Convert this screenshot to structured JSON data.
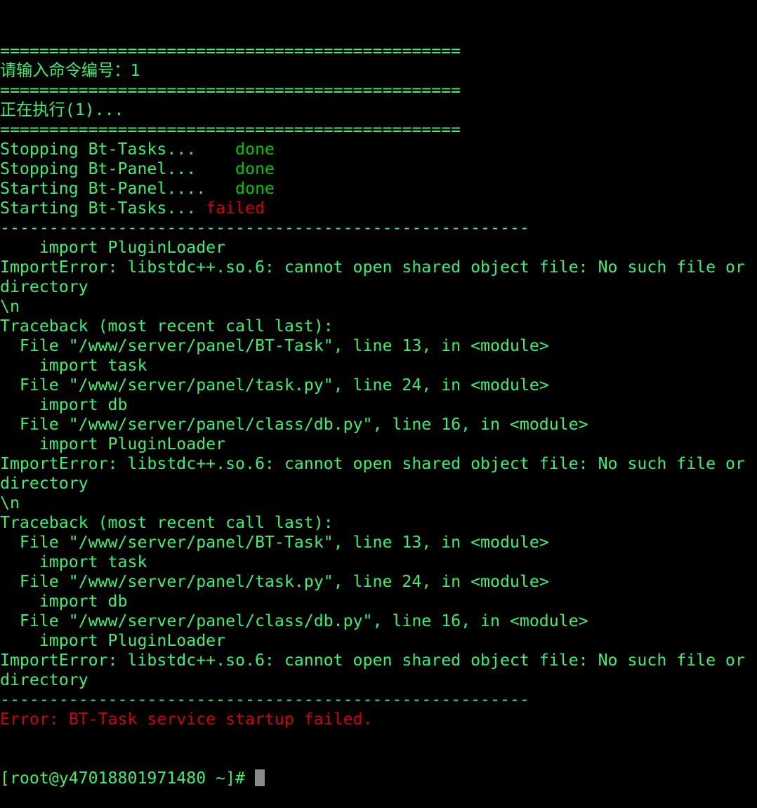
{
  "colors": {
    "text": "#3cf06e",
    "ok": "#00c400",
    "error": "#d40000",
    "background": "#000000"
  },
  "lines": [
    [
      {
        "t": "===============================================",
        "c": ""
      }
    ],
    [
      {
        "t": "请输入命令编号：1",
        "c": ""
      }
    ],
    [
      {
        "t": "===============================================",
        "c": ""
      }
    ],
    [
      {
        "t": "正在执行(1)...",
        "c": ""
      }
    ],
    [
      {
        "t": "===============================================",
        "c": ""
      }
    ],
    [
      {
        "t": "Stopping Bt-Tasks...    ",
        "c": ""
      },
      {
        "t": "done",
        "c": "ok"
      }
    ],
    [
      {
        "t": "Stopping Bt-Panel...    ",
        "c": ""
      },
      {
        "t": "done",
        "c": "ok"
      }
    ],
    [
      {
        "t": "Starting Bt-Panel....   ",
        "c": ""
      },
      {
        "t": "done",
        "c": "ok"
      }
    ],
    [
      {
        "t": "Starting Bt-Tasks... ",
        "c": ""
      },
      {
        "t": "failed",
        "c": "err"
      }
    ],
    [
      {
        "t": "------------------------------------------------------",
        "c": ""
      }
    ],
    [
      {
        "t": "    import PluginLoader",
        "c": ""
      }
    ],
    [
      {
        "t": "ImportError: libstdc++.so.6: cannot open shared object file: No such file or",
        "c": ""
      }
    ],
    [
      {
        "t": "directory",
        "c": ""
      }
    ],
    [
      {
        "t": "\\n",
        "c": ""
      }
    ],
    [
      {
        "t": "Traceback (most recent call last):",
        "c": ""
      }
    ],
    [
      {
        "t": "  File \"/www/server/panel/BT-Task\", line 13, in <module>",
        "c": ""
      }
    ],
    [
      {
        "t": "    import task",
        "c": ""
      }
    ],
    [
      {
        "t": "  File \"/www/server/panel/task.py\", line 24, in <module>",
        "c": ""
      }
    ],
    [
      {
        "t": "    import db",
        "c": ""
      }
    ],
    [
      {
        "t": "  File \"/www/server/panel/class/db.py\", line 16, in <module>",
        "c": ""
      }
    ],
    [
      {
        "t": "    import PluginLoader",
        "c": ""
      }
    ],
    [
      {
        "t": "ImportError: libstdc++.so.6: cannot open shared object file: No such file or",
        "c": ""
      }
    ],
    [
      {
        "t": "directory",
        "c": ""
      }
    ],
    [
      {
        "t": "\\n",
        "c": ""
      }
    ],
    [
      {
        "t": "Traceback (most recent call last):",
        "c": ""
      }
    ],
    [
      {
        "t": "  File \"/www/server/panel/BT-Task\", line 13, in <module>",
        "c": ""
      }
    ],
    [
      {
        "t": "    import task",
        "c": ""
      }
    ],
    [
      {
        "t": "  File \"/www/server/panel/task.py\", line 24, in <module>",
        "c": ""
      }
    ],
    [
      {
        "t": "    import db",
        "c": ""
      }
    ],
    [
      {
        "t": "  File \"/www/server/panel/class/db.py\", line 16, in <module>",
        "c": ""
      }
    ],
    [
      {
        "t": "    import PluginLoader",
        "c": ""
      }
    ],
    [
      {
        "t": "ImportError: libstdc++.so.6: cannot open shared object file: No such file or",
        "c": ""
      }
    ],
    [
      {
        "t": "directory",
        "c": ""
      }
    ],
    [
      {
        "t": "------------------------------------------------------",
        "c": ""
      }
    ],
    [
      {
        "t": "Error: BT-Task service startup failed.",
        "c": "err"
      }
    ]
  ],
  "prompt": "[root@y47018801971480 ~]# "
}
